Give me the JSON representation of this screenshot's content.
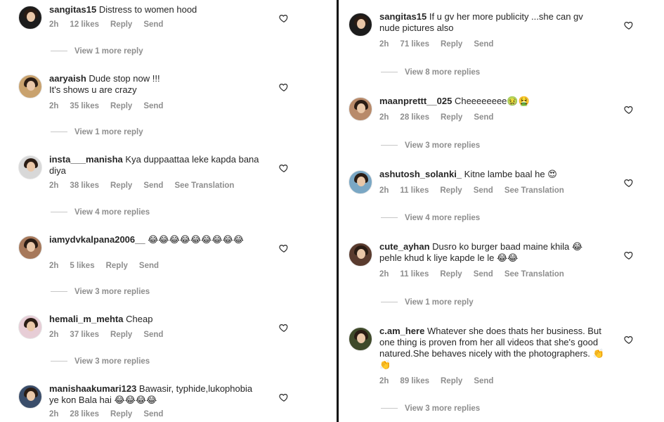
{
  "left_comments": [
    {
      "user": "sangitas15",
      "text": "Distress to women hood",
      "time": "2h",
      "likes": "12 likes",
      "reply": "Reply",
      "send": "Send",
      "translation": "",
      "more": "View 1 more reply",
      "avatar_color": "#1c1c1c"
    },
    {
      "user": "aaryaish",
      "text": "Dude stop now !!!\nIt's shows u are crazy",
      "time": "2h",
      "likes": "35 likes",
      "reply": "Reply",
      "send": "Send",
      "translation": "",
      "more": "View 1 more reply",
      "avatar_color": "#c9a26e"
    },
    {
      "user": "insta___manisha",
      "text": "Kya duppaattaa leke kapda bana diya",
      "time": "2h",
      "likes": "38 likes",
      "reply": "Reply",
      "send": "Send",
      "translation": "See Translation",
      "more": "View 4 more replies",
      "avatar_color": "#d8d8d8"
    },
    {
      "user": "iamydvkalpana2006__",
      "text": "😂😂😂😂😂😂😂😂😂",
      "time": "2h",
      "likes": "5 likes",
      "reply": "Reply",
      "send": "Send",
      "translation": "",
      "more": "View 3 more replies",
      "avatar_color": "#a6785a"
    },
    {
      "user": "hemali_m_mehta",
      "text": "Cheap",
      "time": "2h",
      "likes": "37 likes",
      "reply": "Reply",
      "send": "Send",
      "translation": "",
      "more": "View 3 more replies",
      "avatar_color": "#e7cdd6"
    },
    {
      "user": "manishaakumari123",
      "text": "Bawasir, typhide,lukophobia ye kon Bala hai 😂😂😂😂",
      "time": "2h",
      "likes": "28 likes",
      "reply": "Reply",
      "send": "Send",
      "translation": "",
      "more": "",
      "avatar_color": "#3a4d6a"
    }
  ],
  "right_comments": [
    {
      "user": "sangitas15",
      "text": "If u gv her more publicity ...she can gv nude pictures also",
      "time": "2h",
      "likes": "71 likes",
      "reply": "Reply",
      "send": "Send",
      "translation": "",
      "more": "View 8 more replies",
      "avatar_color": "#1c1c1c"
    },
    {
      "user": "maanprettt__025",
      "text": "Cheeeeeeee🤢🤮",
      "time": "2h",
      "likes": "28 likes",
      "reply": "Reply",
      "send": "Send",
      "translation": "",
      "more": "View 3 more replies",
      "avatar_color": "#b88a6a"
    },
    {
      "user": "ashutosh_solanki_",
      "text": "Kitne lambe baal he 😍",
      "time": "2h",
      "likes": "11 likes",
      "reply": "Reply",
      "send": "Send",
      "translation": "See Translation",
      "more": "View 4 more replies",
      "avatar_color": "#7aa7c4"
    },
    {
      "user": "cute_ayhan",
      "text": "Dusro ko burger baad maine khila 😂 pehle khud k liye kapde le le 😂😂",
      "time": "2h",
      "likes": "11 likes",
      "reply": "Reply",
      "send": "Send",
      "translation": "See Translation",
      "more": "View 1 more reply",
      "avatar_color": "#5a3b2e"
    },
    {
      "user": "c.am_here",
      "text": "Whatever she does thats her business. But one thing is proven from her all videos that she's good natured.She behaves nicely with the photographers. 👏👏",
      "time": "2h",
      "likes": "89 likes",
      "reply": "Reply",
      "send": "Send",
      "translation": "",
      "more": "View 3 more replies",
      "avatar_color": "#3f4a2a"
    }
  ],
  "icons": {
    "heart": "heart-outline-icon"
  }
}
